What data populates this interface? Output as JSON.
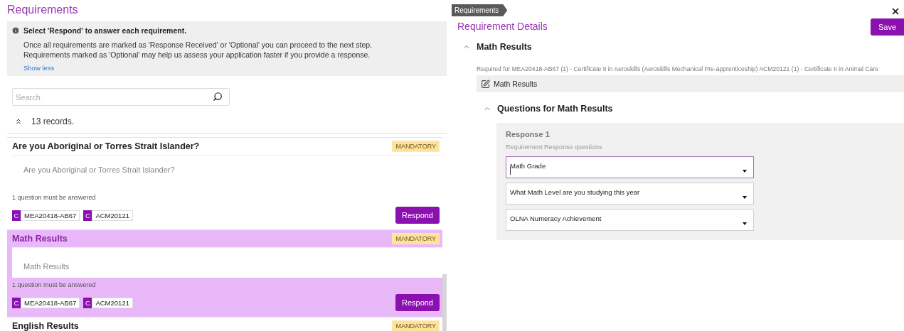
{
  "header": {
    "title": "Requirements"
  },
  "info": {
    "heading": "Select 'Respond' to answer each requirement.",
    "lines": [
      "Once all requirements are marked as 'Response Received' or 'Optional' you can proceed to the next step.",
      "Requirements marked as 'Optional' may help us assess your application faster if you provide a response."
    ],
    "toggle": "Show less"
  },
  "search": {
    "placeholder": "Search"
  },
  "records": "13 records.",
  "requirements": [
    {
      "title": "Are you Aboriginal or Torres Strait Islander?",
      "badge": "MANDATORY",
      "question": "Are you Aboriginal or Torres Strait Islander?",
      "note": "1 question must be answered",
      "tags": [
        {
          "type": "C",
          "code": "MEA20418-AB67"
        },
        {
          "type": "C",
          "code": "ACM20121"
        }
      ],
      "action": "Respond",
      "selected": false
    },
    {
      "title": "Math Results",
      "badge": "MANDATORY",
      "question": "Math Results",
      "note": "1 question must be answered",
      "tags": [
        {
          "type": "C",
          "code": "MEA20418-AB67"
        },
        {
          "type": "C",
          "code": "ACM20121"
        }
      ],
      "action": "Respond",
      "selected": true
    },
    {
      "title": "English Results",
      "badge": "MANDATORY",
      "selected": false
    }
  ],
  "details": {
    "breadcrumb": "Requirements",
    "title": "Requirement Details",
    "save": "Save",
    "section": "Math Results",
    "required_for": "Required for MEA20418-AB67 (1) - Certificate II in Aeroskills (Aeroskills Mechanical Pre-apprenticeship) ACM20121 (1) - Certificate II in Animal Care",
    "item": "Math Results",
    "questions_title": "Questions for Math Results",
    "response": {
      "title": "Response 1",
      "subtitle": "Requirement Response questions",
      "fields": [
        {
          "label": "Math Grade",
          "focused": true
        },
        {
          "label": "What Math Level are you studying this year",
          "focused": false
        },
        {
          "label": "OLNA Numeracy Achievement",
          "focused": false
        }
      ]
    }
  }
}
